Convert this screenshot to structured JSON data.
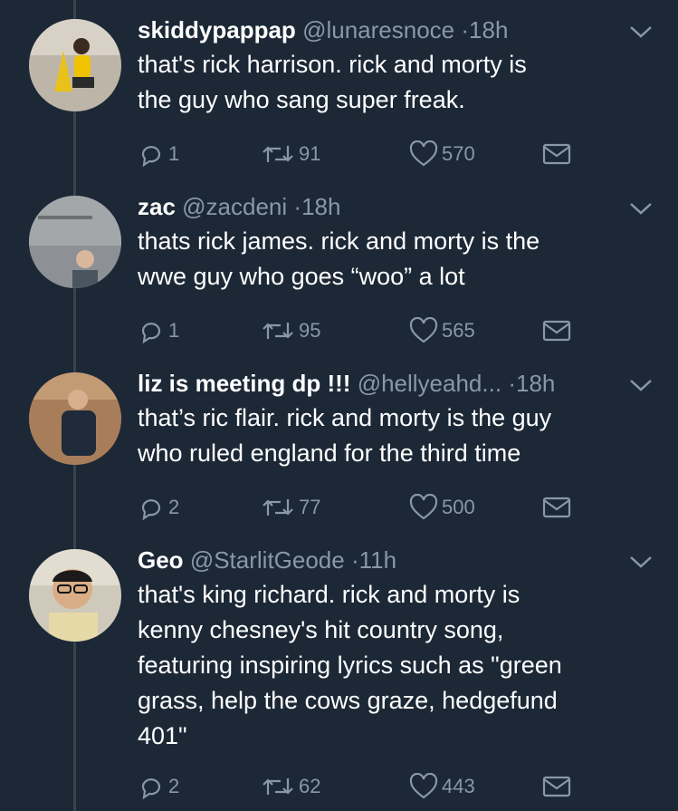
{
  "tweets": [
    {
      "display_name": "skiddypappap",
      "handle": "@lunaresnoce",
      "time": "18h",
      "lines": [
        "that's rick harrison. rick and morty is",
        "the guy who sang super freak."
      ],
      "replies": "1",
      "retweets": "91",
      "likes": "570"
    },
    {
      "display_name": "zac",
      "handle": "@zacdeni",
      "time": "18h",
      "lines": [
        "thats rick james. rick and morty is the",
        "wwe guy who goes “woo” a lot"
      ],
      "replies": "1",
      "retweets": "95",
      "likes": "565"
    },
    {
      "display_name": "liz is meeting dp !!!",
      "handle": "@hellyeahd...",
      "time": "18h",
      "lines": [
        "that’s ric flair. rick and morty is the guy",
        "who ruled england for the third time"
      ],
      "replies": "2",
      "retweets": "77",
      "likes": "500"
    },
    {
      "display_name": "Geo",
      "handle": "@StarlitGeode",
      "time": "11h",
      "lines": [
        "that's king richard. rick and morty is",
        "kenny chesney's hit country song,",
        "featuring inspiring lyrics such as \"green",
        "grass, help the cows graze, hedgefund",
        "401\""
      ],
      "replies": "2",
      "retweets": "62",
      "likes": "443"
    }
  ],
  "separator": "·",
  "colors": {
    "background": "#1c2836",
    "secondary_text": "#8899a6",
    "thread_line": "#38444d"
  },
  "icons": [
    "reply-icon",
    "retweet-icon",
    "like-icon",
    "direct-message-icon",
    "chevron-down-icon"
  ]
}
